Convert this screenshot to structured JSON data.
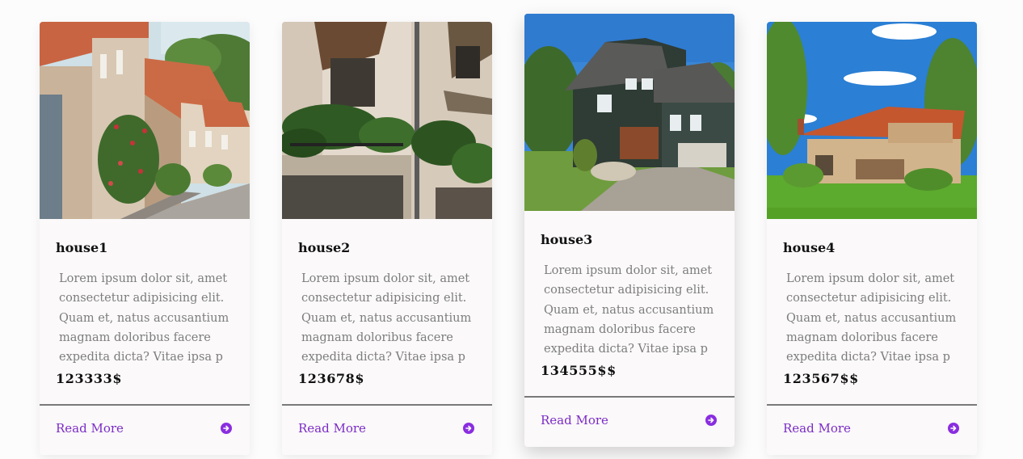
{
  "cards": [
    {
      "title": "house1",
      "description": "Lorem ipsum dolor sit, amet consectetur adipisicing elit. Quam et, natus accusantium magnam doloribus facere expedita dicta? Vitae ipsa p",
      "price": "123333$",
      "link_label": "Read More",
      "image_icon": "street-houses-photo"
    },
    {
      "title": "house2",
      "description": "Lorem ipsum dolor sit, amet consectetur adipisicing elit. Quam et, natus accusantium magnam doloribus facere expedita dicta? Vitae ipsa p",
      "price": "123678$",
      "link_label": "Read More",
      "image_icon": "balcony-building-photo"
    },
    {
      "title": "house3",
      "description": "Lorem ipsum dolor sit, amet consectetur adipisicing elit. Quam et, natus accusantium magnam doloribus facere expedita dicta? Vitae ipsa p",
      "price": "134555$$",
      "link_label": "Read More",
      "image_icon": "suburban-house-photo"
    },
    {
      "title": "house4",
      "description": "Lorem ipsum dolor sit, amet consectetur adipisicing elit. Quam et, natus accusantium magnam doloribus facere expedita dicta? Vitae ipsa p",
      "price": "123567$$",
      "link_label": "Read More",
      "image_icon": "countryside-house-photo"
    }
  ],
  "colors": {
    "accent": "#8a2ee0",
    "link": "#7b2cc7",
    "card_bg": "#fbf9f9",
    "text_muted": "#7d7d7d"
  }
}
